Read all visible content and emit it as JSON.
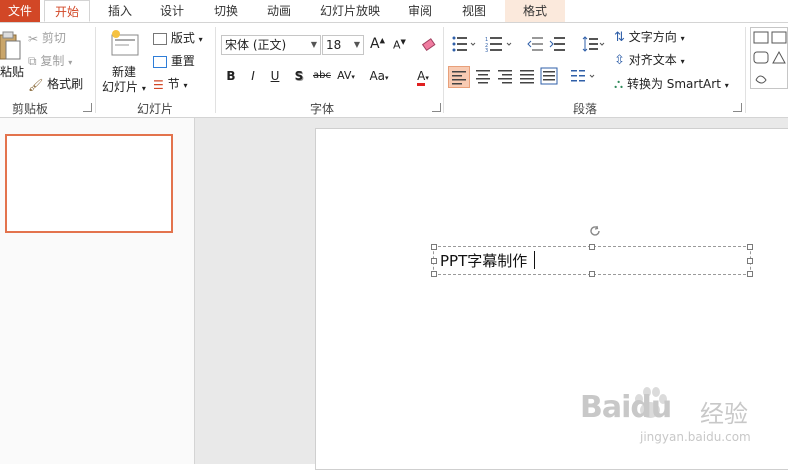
{
  "tabs": [
    {
      "label": "文件"
    },
    {
      "label": "开始"
    },
    {
      "label": "插入"
    },
    {
      "label": "设计"
    },
    {
      "label": "切换"
    },
    {
      "label": "动画"
    },
    {
      "label": "幻灯片放映"
    },
    {
      "label": "审阅"
    },
    {
      "label": "视图"
    },
    {
      "label": "格式"
    }
  ],
  "clipboard": {
    "group_label": "剪贴板",
    "paste_label": "粘贴",
    "cut_label": "剪切",
    "copy_label": "复制",
    "format_painter_label": "格式刷"
  },
  "slides": {
    "group_label": "幻灯片",
    "new_slide_label_1": "新建",
    "new_slide_label_2": "幻灯片",
    "layout_label": "版式",
    "reset_label": "重置",
    "section_label": "节"
  },
  "font": {
    "group_label": "字体",
    "font_name": "宋体 (正文)",
    "font_size": "18",
    "bold": "B",
    "italic": "I",
    "underline": "U",
    "shadow": "S",
    "strikethrough": "abc",
    "spacing": "AV",
    "case": "Aa",
    "color": "A",
    "grow": "A",
    "shrink": "A"
  },
  "paragraph": {
    "group_label": "段落",
    "text_direction_label": "文字方向",
    "align_text_label": "对齐文本",
    "smartart_label": "转换为 SmartArt"
  },
  "slide": {
    "textbox_text": "PPT字幕制作"
  },
  "watermark": {
    "brand": "Baidu",
    "cn": "经验",
    "url": "jingyan.baidu.com"
  },
  "colors": {
    "accent": "#d24726",
    "thumb_border": "#e3734d",
    "format_tab_bg": "#fbe9dc",
    "align_active_bg": "#f8cbb3"
  }
}
